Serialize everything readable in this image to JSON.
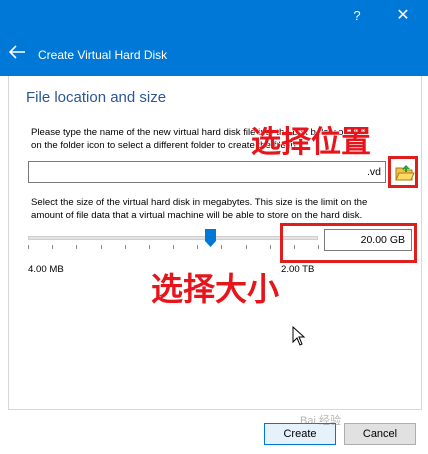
{
  "window": {
    "title": "Create Virtual Hard Disk",
    "help_label": "?",
    "close_label": "✕"
  },
  "section": {
    "title": "File location and size"
  },
  "location": {
    "description": "Please type the name of the new virtual hard disk file into the box below or click\non the folder icon to select a different folder to create the file in.",
    "file_value_suffix": ".vd",
    "annotation": "选择位置"
  },
  "size": {
    "description": "Select the size of the virtual hard disk in megabytes. This size is the limit on the\namount of file data that a virtual machine will be able to store on the hard disk.",
    "value": "20.00 GB",
    "min_label": "4.00 MB",
    "max_label": "2.00 TB",
    "slider_fraction": 0.63,
    "annotation": "选择大小"
  },
  "buttons": {
    "create": "Create",
    "cancel": "Cancel"
  },
  "watermark": "Bai 经验",
  "colors": {
    "titlebar": "#0078d7",
    "annotation": "#e8141b"
  }
}
